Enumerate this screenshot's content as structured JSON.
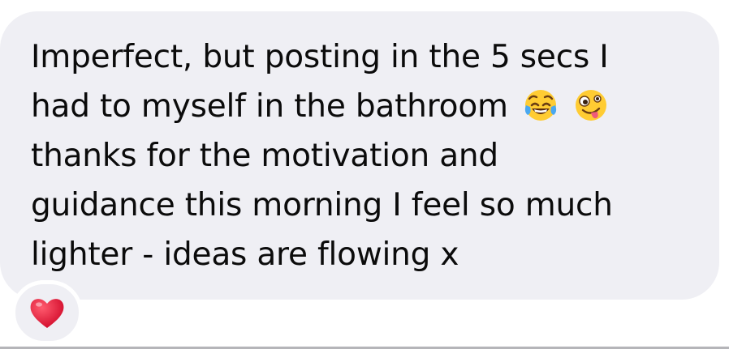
{
  "message": {
    "lines": [
      "Imperfect, but posting in the 5 secs I",
      "had to myself in the bathroom",
      "thanks for the motivation and",
      "guidance this morning I feel so much",
      "lighter - ideas are flowing x"
    ],
    "emojis": [
      "face-with-tears-of-joy-icon",
      "zany-face-icon"
    ]
  },
  "reaction": {
    "icon": "red-heart-icon"
  },
  "colors": {
    "bubble_background": "#efeff4",
    "text": "#0b0b0b",
    "heart": "#e0102f"
  }
}
